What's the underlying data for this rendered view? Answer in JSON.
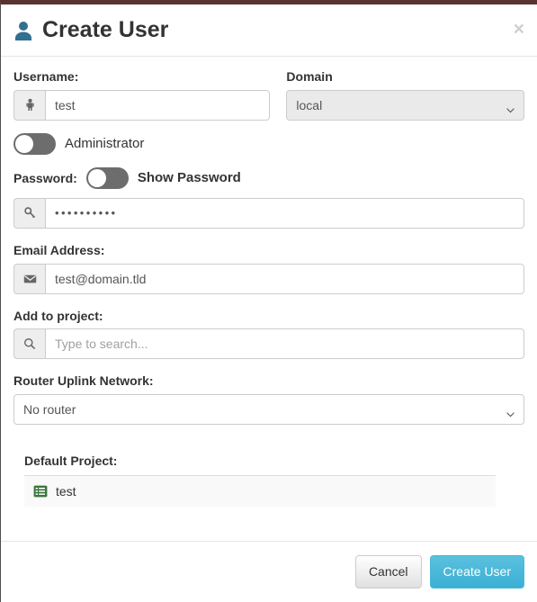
{
  "modal": {
    "title": "Create User",
    "title_icon": "user-icon",
    "close_label": "×",
    "accent_top_color": "#5a3330"
  },
  "form": {
    "username": {
      "label": "Username:",
      "icon": "user-icon",
      "value": "test",
      "placeholder": ""
    },
    "domain": {
      "label": "Domain",
      "selected": "local",
      "options": [
        "local"
      ]
    },
    "administrator": {
      "label": "Administrator",
      "state": "off"
    },
    "password": {
      "label": "Password:",
      "show_password_label": "Show Password",
      "show_password_state": "off",
      "icon": "key-icon",
      "value": "••••••••••"
    },
    "email": {
      "label": "Email Address:",
      "icon": "envelope-icon",
      "value": "test@domain.tld",
      "placeholder": ""
    },
    "add_to_project": {
      "label": "Add to project:",
      "icon": "search-icon",
      "value": "",
      "placeholder": "Type to search..."
    },
    "router_uplink": {
      "label": "Router Uplink Network:",
      "selected": "No router",
      "options": [
        "No router"
      ]
    },
    "default_project": {
      "label": "Default Project:",
      "items": [
        {
          "icon": "project-list-icon",
          "name": "test"
        }
      ]
    }
  },
  "footer": {
    "cancel_label": "Cancel",
    "submit_label": "Create User",
    "submit_color": "#5bc0de"
  }
}
